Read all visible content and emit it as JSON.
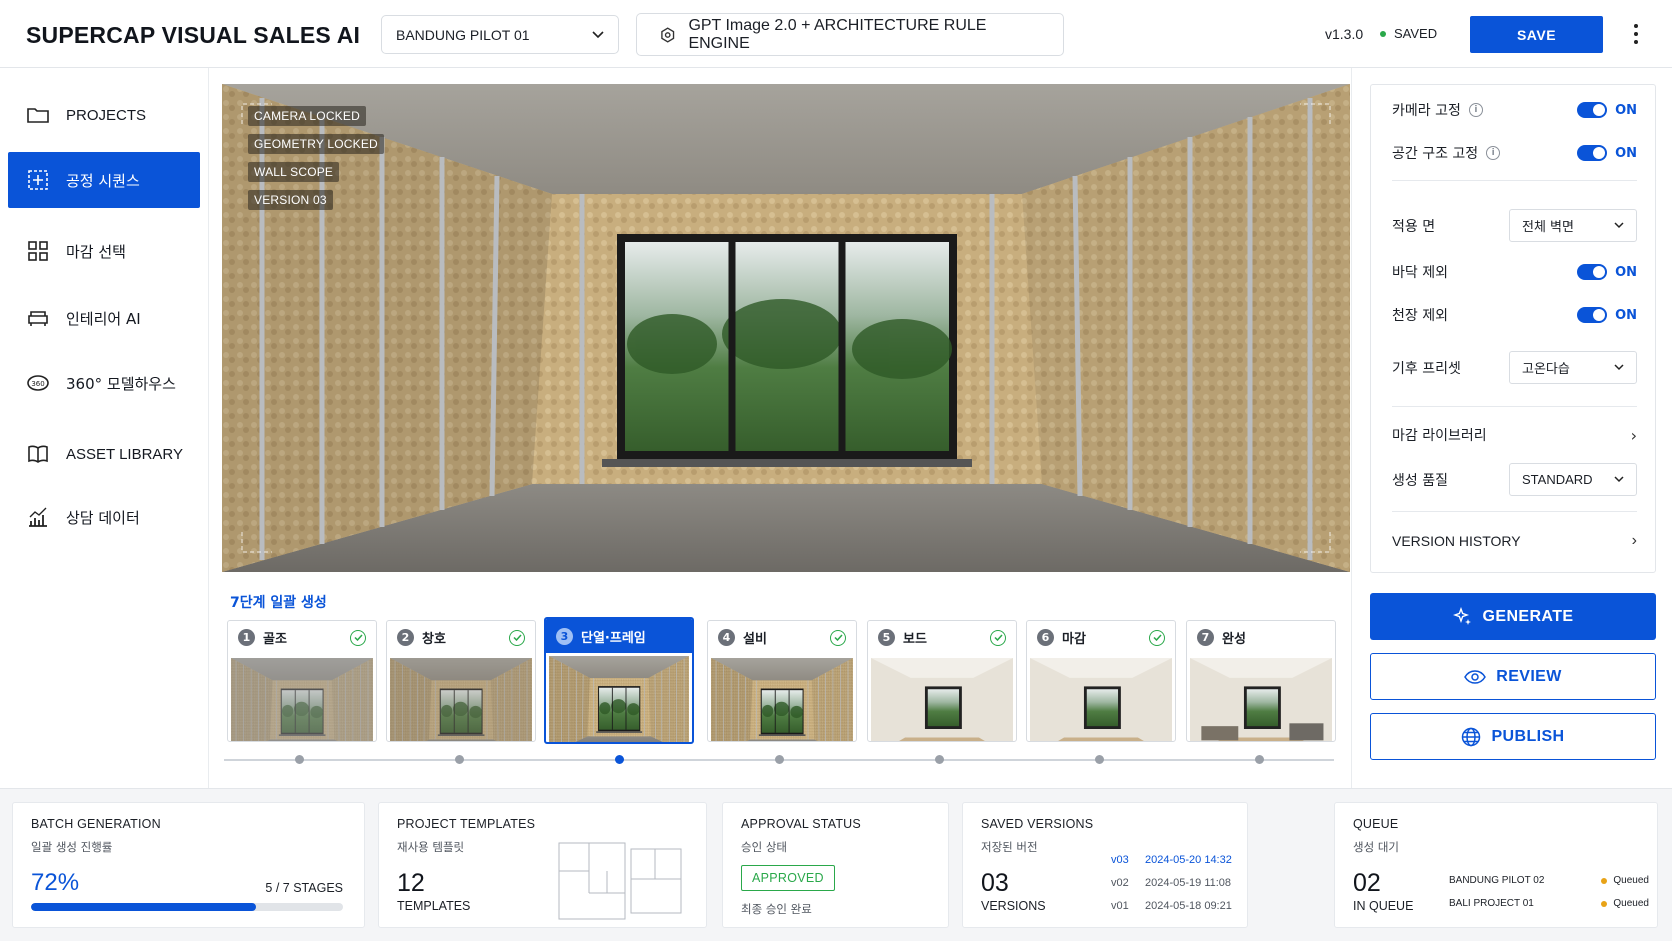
{
  "header": {
    "brand": "SUPERCAP VISUAL SALES AI",
    "project": "BANDUNG PILOT 01",
    "engine": "GPT Image 2.0 + ARCHITECTURE RULE ENGINE",
    "version": "v1.3.0",
    "saved": "SAVED",
    "save_label": "SAVE"
  },
  "sidebar": {
    "items": [
      {
        "label": "PROJECTS",
        "icon": "folder-icon"
      },
      {
        "label": "공정 시퀀스",
        "icon": "sequence-icon"
      },
      {
        "label": "마감 선택",
        "icon": "grid-icon"
      },
      {
        "label": "인테리어 AI",
        "icon": "sofa-icon"
      },
      {
        "label": "360° 모델하우스",
        "icon": "360-icon"
      },
      {
        "label": "ASSET LIBRARY",
        "icon": "book-icon"
      },
      {
        "label": "상담 데이터",
        "icon": "chart-icon"
      }
    ]
  },
  "viewer": {
    "tags": [
      "CAMERA LOCKED",
      "GEOMETRY LOCKED",
      "WALL SCOPE",
      "VERSION 03"
    ]
  },
  "stages": {
    "title": "7단계 일괄 생성",
    "items": [
      {
        "n": "1",
        "label": "골조",
        "done": true
      },
      {
        "n": "2",
        "label": "창호",
        "done": true
      },
      {
        "n": "3",
        "label": "단열·프레임",
        "done": false
      },
      {
        "n": "4",
        "label": "설비",
        "done": true
      },
      {
        "n": "5",
        "label": "보드",
        "done": true
      },
      {
        "n": "6",
        "label": "마감",
        "done": true
      },
      {
        "n": "7",
        "label": "완성",
        "done": false
      }
    ]
  },
  "settings": {
    "camera_lock": "카메라 고정",
    "structure_lock": "공간 구조 고정",
    "on": "ON",
    "apply_surface": "적용 면",
    "apply_surface_value": "전체 벽면",
    "exclude_floor": "바닥 제외",
    "exclude_ceiling": "천장 제외",
    "climate": "기후 프리셋",
    "climate_value": "고온다습",
    "finish_library": "마감 라이브러리",
    "quality": "생성 품질",
    "quality_value": "STANDARD",
    "version_history": "VERSION HISTORY"
  },
  "actions": {
    "generate": "GENERATE",
    "review": "REVIEW",
    "publish": "PUBLISH"
  },
  "footer": {
    "batch": {
      "title": "BATCH GENERATION",
      "sub": "일괄 생성 진행률",
      "percent": "72%",
      "progress": 0.72,
      "stages": "5 / 7 STAGES"
    },
    "templates": {
      "title": "PROJECT TEMPLATES",
      "sub": "재사용 템플릿",
      "count": "12",
      "caption": "TEMPLATES"
    },
    "approval": {
      "title": "APPROVAL STATUS",
      "sub": "승인 상태",
      "badge": "APPROVED",
      "note": "최종 승인 완료"
    },
    "versions": {
      "title": "SAVED VERSIONS",
      "sub": "저장된 버전",
      "count": "03",
      "caption": "VERSIONS",
      "list": [
        {
          "v": "v03",
          "date": "2024-05-20 14:32"
        },
        {
          "v": "v02",
          "date": "2024-05-19 11:08"
        },
        {
          "v": "v01",
          "date": "2024-05-18 09:21"
        }
      ]
    },
    "queue": {
      "title": "QUEUE",
      "sub": "생성 대기",
      "count": "02",
      "caption": "IN QUEUE",
      "items": [
        {
          "name": "BANDUNG PILOT 02",
          "status": "Queued"
        },
        {
          "name": "BALI PROJECT 01",
          "status": "Queued"
        }
      ]
    }
  },
  "colors": {
    "accent": "#0a54d8",
    "success": "#2aa84a",
    "queued": "#e8a317"
  }
}
